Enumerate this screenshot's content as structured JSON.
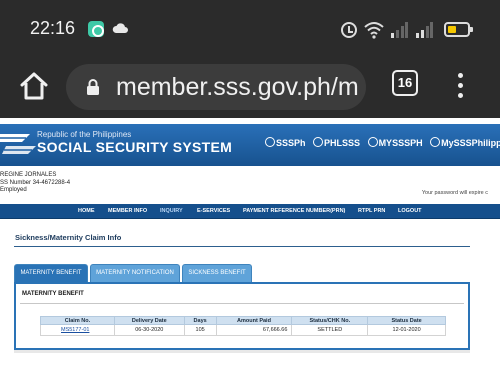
{
  "status_bar": {
    "time": "22:16",
    "icons": [
      "messenger-app-icon",
      "cloud-icon",
      "alarm-icon",
      "wifi-icon",
      "signal-icon",
      "signal-icon",
      "battery-icon"
    ]
  },
  "browser": {
    "url": "member.sss.gov.ph/m",
    "tab_count": "16"
  },
  "header": {
    "republic": "Republic of the Philippines",
    "title": "SOCIAL SECURITY SYSTEM",
    "socials": [
      "SSSPh",
      "PHLSSS",
      "MYSSSPH",
      "MySSSPhilippines"
    ]
  },
  "user": {
    "name": "REGINE JORNALES",
    "ss_number": "SS Number 34-4672288-4",
    "status": "Employed",
    "password_notice": "Your password will expire c"
  },
  "nav": {
    "items": [
      "HOME",
      "MEMBER INFO",
      "INQUIRY",
      "E-SERVICES",
      "PAYMENT REFERENCE NUMBER(PRN)",
      "RTPL PRN",
      "LOGOUT"
    ],
    "active": "INQUIRY"
  },
  "page": {
    "title": "Sickness/Maternity Claim Info",
    "tabs": [
      "MATERNITY BENEFIT",
      "MATERNITY NOTIFICATION",
      "SICKNESS BENEFIT"
    ],
    "panel_title": "MATERNITY BENEFIT"
  },
  "table": {
    "headers": [
      "Claim No.",
      "Delivery Date",
      "Days",
      "Amount Paid",
      "Status/CHK No.",
      "Status Date"
    ],
    "rows": [
      [
        "MS5177-01",
        "06-30-2020",
        "105",
        "67,666.66",
        "SETTLED",
        "12-01-2020"
      ]
    ]
  },
  "colors": {
    "header_blue": "#1c5fa3",
    "nav_blue": "#154f8c",
    "tab_blue": "#5fa3d9",
    "active_tab_blue": "#2a73b6",
    "status_bar": "#2b2b2b"
  }
}
